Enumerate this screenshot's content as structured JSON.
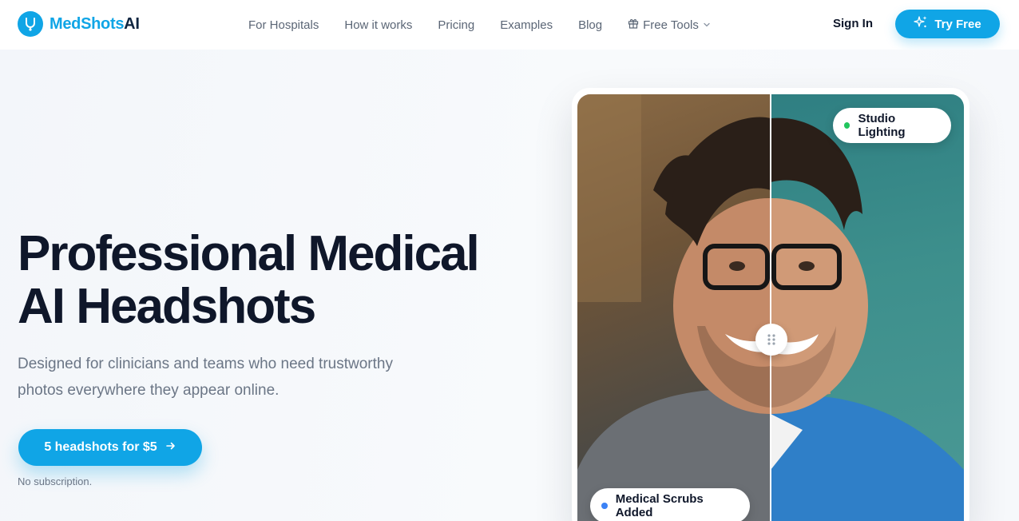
{
  "brand": {
    "name_part1": "MedShots",
    "name_part2": "AI",
    "accent": "#10a5e6"
  },
  "nav": {
    "items": [
      {
        "label": "For Hospitals"
      },
      {
        "label": "How it works"
      },
      {
        "label": "Pricing"
      },
      {
        "label": "Examples"
      },
      {
        "label": "Blog"
      },
      {
        "label": "Free Tools",
        "icon": "gift-icon",
        "has_dropdown": true
      }
    ]
  },
  "header": {
    "signin_label": "Sign In",
    "try_label": "Try Free"
  },
  "hero": {
    "title_line1": "Professional Medical",
    "title_line2": "AI Headshots",
    "subtitle_line1": "Designed for clinicians and teams who need trustworthy",
    "subtitle_line2": "photos everywhere they appear online.",
    "cta_label": "5 headshots for $5",
    "note": "No subscription."
  },
  "comparison": {
    "badge_top": {
      "label": "Studio Lighting",
      "dot_color": "#22c55e"
    },
    "badge_bottom": {
      "label": "Medical Scrubs Added",
      "dot_color": "#3b82f6"
    },
    "slider_position": 0.5
  }
}
